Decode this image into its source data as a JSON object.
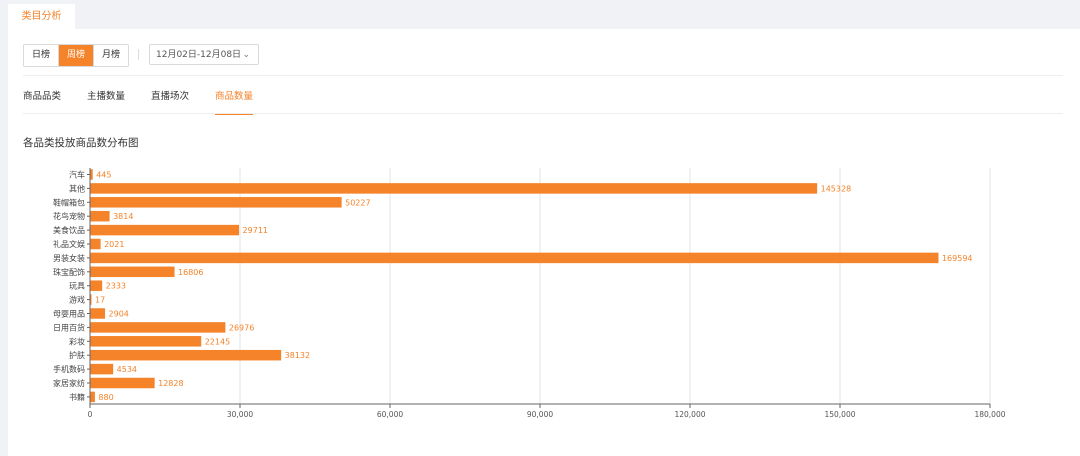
{
  "top_tab": {
    "label": "类目分析"
  },
  "period": {
    "options": [
      "日榜",
      "周榜",
      "月榜"
    ],
    "selected": "周榜"
  },
  "date_range": {
    "value": "12月02日-12月08日"
  },
  "metric_tabs": {
    "items": [
      "商品品类",
      "主播数量",
      "直播场次",
      "商品数量"
    ],
    "selected": "商品数量"
  },
  "colors": {
    "accent": "#f5832a",
    "bar": "#f5832a"
  },
  "chart_data": {
    "type": "bar",
    "orientation": "horizontal",
    "title": "各品类投放商品数分布图",
    "categories": [
      "汽车",
      "其他",
      "鞋帽箱包",
      "花鸟宠物",
      "美食饮品",
      "礼品文娱",
      "男装女装",
      "珠宝配饰",
      "玩具",
      "游戏",
      "母婴用品",
      "日用百货",
      "彩妆",
      "护肤",
      "手机数码",
      "家居家纺",
      "书籍"
    ],
    "values": [
      445,
      145328,
      50227,
      3814,
      29711,
      2021,
      169594,
      16806,
      2333,
      17,
      2904,
      26976,
      22145,
      38132,
      4534,
      12828,
      880
    ],
    "xlim": [
      0,
      180000
    ],
    "xticks": [
      0,
      30000,
      60000,
      90000,
      120000,
      150000,
      180000
    ],
    "xtick_labels": [
      "0",
      "30,000",
      "60,000",
      "90,000",
      "120,000",
      "150,000",
      "180,000"
    ],
    "grid": true,
    "data_labels": true
  }
}
